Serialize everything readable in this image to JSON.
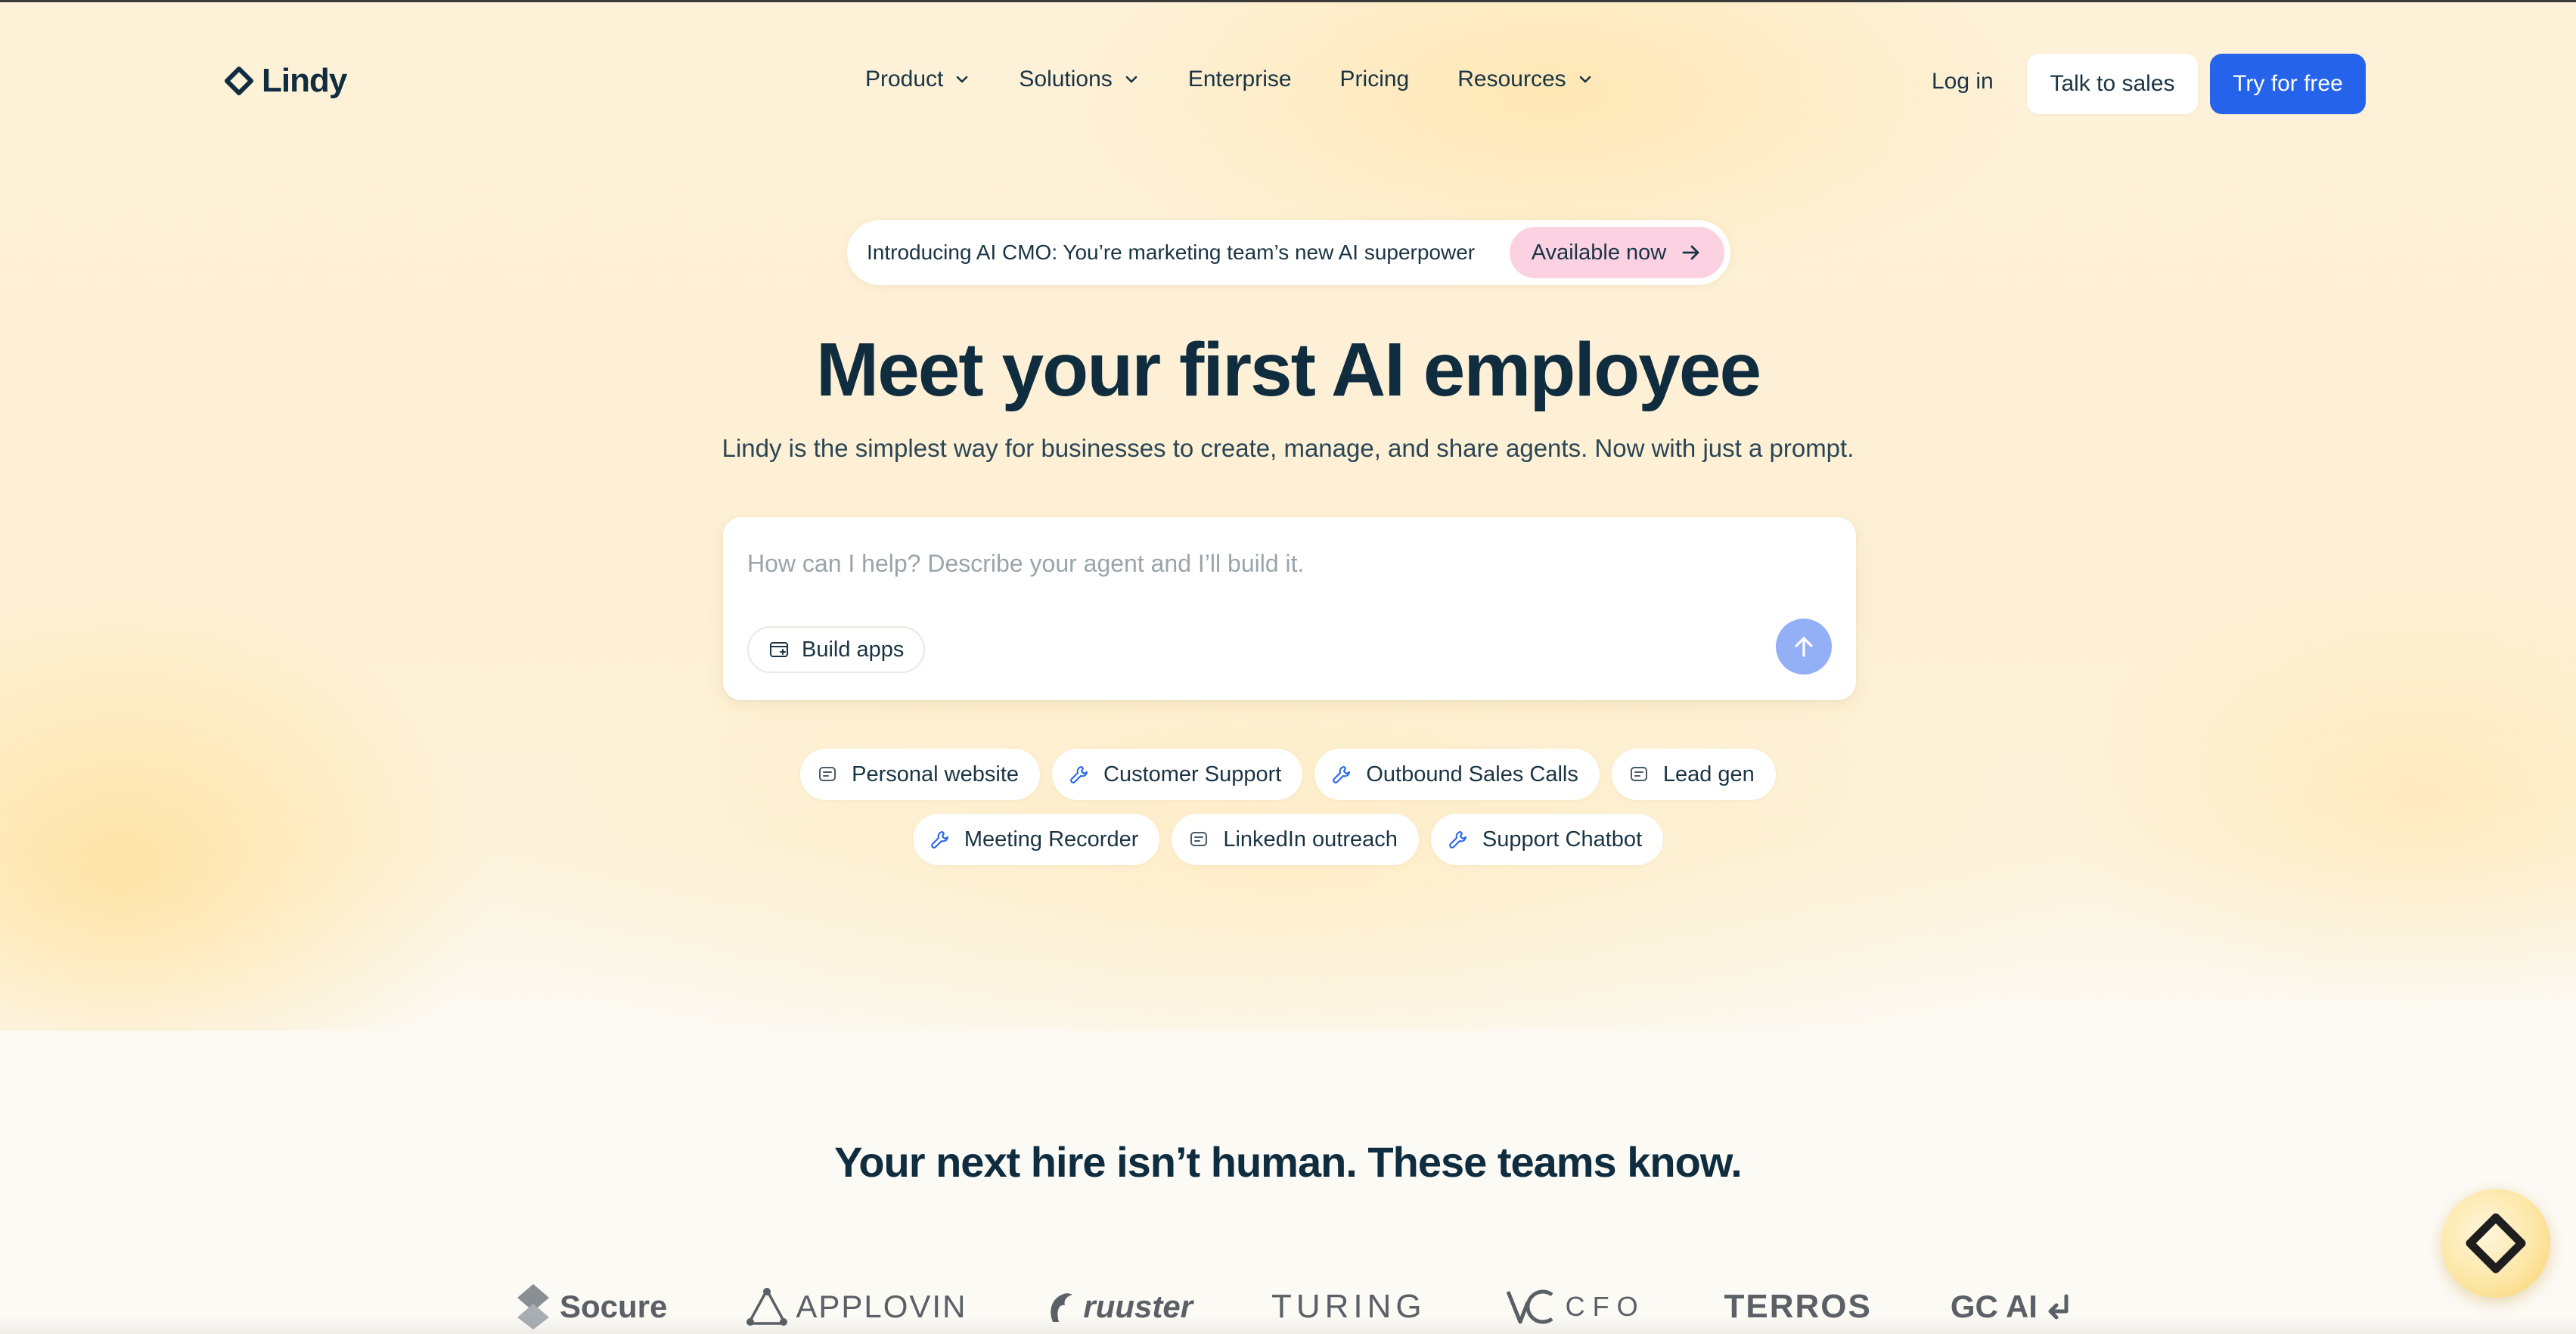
{
  "brand": {
    "name": "Lindy"
  },
  "nav": {
    "items": [
      {
        "label": "Product",
        "has_dropdown": true
      },
      {
        "label": "Solutions",
        "has_dropdown": true
      },
      {
        "label": "Enterprise",
        "has_dropdown": false
      },
      {
        "label": "Pricing",
        "has_dropdown": false
      },
      {
        "label": "Resources",
        "has_dropdown": true
      }
    ],
    "login": "Log in",
    "talk_to_sales": "Talk to sales",
    "try_free": "Try for free"
  },
  "announcement": {
    "text": "Introducing AI CMO: You’re marketing team’s new AI superpower",
    "pill": "Available now"
  },
  "hero": {
    "title": "Meet your first AI employee",
    "subtitle": "Lindy is the simplest way for businesses to create, manage, and share agents. Now with just a prompt."
  },
  "prompt": {
    "placeholder": "How can I help? Describe your agent and I’ll build it.",
    "value": "",
    "build_apps": "Build apps"
  },
  "suggestions": {
    "row1": [
      {
        "label": "Personal website",
        "icon": "chat-icon"
      },
      {
        "label": "Customer Support",
        "icon": "wrench-icon"
      },
      {
        "label": "Outbound Sales Calls",
        "icon": "wrench-icon"
      },
      {
        "label": "Lead gen",
        "icon": "chat-icon"
      }
    ],
    "row2": [
      {
        "label": "Meeting Recorder",
        "icon": "wrench-icon"
      },
      {
        "label": "LinkedIn outreach",
        "icon": "chat-icon"
      },
      {
        "label": "Support Chatbot",
        "icon": "wrench-icon"
      }
    ]
  },
  "social_proof": {
    "title": "Your next hire isn’t human. These teams know.",
    "logos": [
      "Socure",
      "APPLOVIN",
      "ruuster",
      "TURING",
      "CFO",
      "TERROS",
      "GC AI"
    ]
  },
  "colors": {
    "primary": "#2563eb",
    "text": "#0f2d3f",
    "pill_pink": "#fcd2e2",
    "send_button": "#93aff5",
    "hero_bg": "#fdf1d8"
  }
}
